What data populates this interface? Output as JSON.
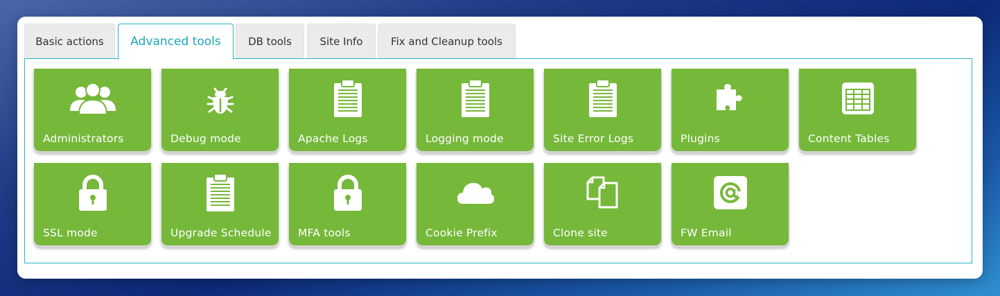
{
  "tabs": [
    {
      "label": "Basic actions",
      "active": false
    },
    {
      "label": "Advanced tools",
      "active": true
    },
    {
      "label": "DB tools",
      "active": false
    },
    {
      "label": "Site Info",
      "active": false
    },
    {
      "label": "Fix and Cleanup tools",
      "active": false
    }
  ],
  "tiles": [
    {
      "label": "Administrators",
      "icon": "users-icon"
    },
    {
      "label": "Debug mode",
      "icon": "bug-icon"
    },
    {
      "label": "Apache Logs",
      "icon": "clipboard-icon"
    },
    {
      "label": "Logging mode",
      "icon": "clipboard-icon"
    },
    {
      "label": "Site Error Logs",
      "icon": "clipboard-icon"
    },
    {
      "label": "Plugins",
      "icon": "puzzle-icon"
    },
    {
      "label": "Content Tables",
      "icon": "table-icon"
    },
    {
      "label": "SSL mode",
      "icon": "lock-icon"
    },
    {
      "label": "Upgrade Schedule",
      "icon": "clipboard-icon"
    },
    {
      "label": "MFA tools",
      "icon": "lock-icon"
    },
    {
      "label": "Cookie Prefix",
      "icon": "cloud-icon"
    },
    {
      "label": "Clone site",
      "icon": "copy-icon"
    },
    {
      "label": "FW Email",
      "icon": "at-sign-icon"
    }
  ],
  "colors": {
    "tile_bg": "#76b83a",
    "accent": "#25b5c6",
    "active_tab_text": "#1aa6b7"
  }
}
